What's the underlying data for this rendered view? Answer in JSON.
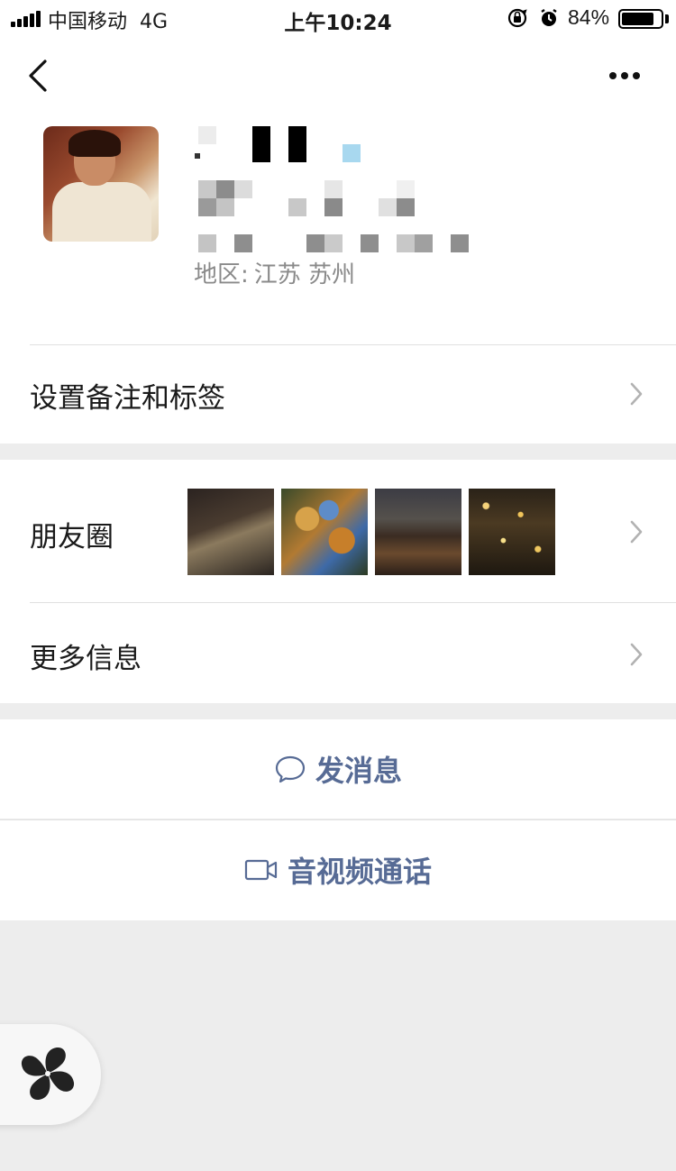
{
  "status_bar": {
    "carrier": "中国移动",
    "network": "4G",
    "time": "上午10:24",
    "battery": "84%",
    "battery_level": 0.84
  },
  "profile": {
    "region_label": "地区:",
    "region_value": "江苏 苏州"
  },
  "rows": {
    "remark_tags": "设置备注和标签",
    "moments": "朋友圈",
    "more_info": "更多信息"
  },
  "actions": {
    "message": "发消息",
    "call": "音视频通话"
  },
  "icons": {
    "back": "back-arrow-icon",
    "more": "more-dots-icon",
    "chevron": "chevron-right-icon",
    "message": "chat-bubble-icon",
    "call": "video-camera-icon",
    "floating": "pinwheel-icon"
  },
  "colors": {
    "link_blue": "#576b95",
    "background": "#ededed"
  }
}
